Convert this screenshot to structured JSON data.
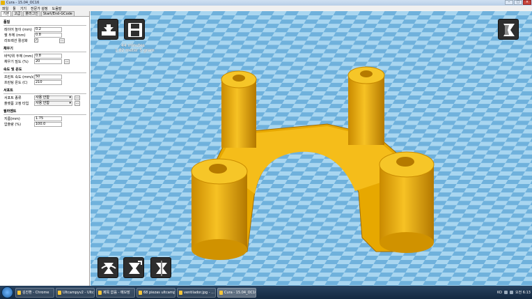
{
  "window": {
    "title": "Cura - 15.04_OC16"
  },
  "menu": [
    "파일",
    "툴",
    "기기",
    "전문가 설정",
    "도움말"
  ],
  "tabs": [
    "기본",
    "고급",
    "플러그인",
    "Start/End-GCode"
  ],
  "sections": {
    "quality": {
      "title": "품질",
      "layer_height_label": "레이어 높이 (mm)",
      "layer_height": "0.2",
      "shell_label": "쉘 두께 (mm)",
      "shell": "0.8",
      "retraction_label": "리트랙션 활성화",
      "retraction_checked": "✓"
    },
    "fill": {
      "title": "채우기",
      "bottom_top_label": "바닥/위 두께 (mm)",
      "bottom_top": "0.8",
      "density_label": "채우기 밀도 (%)",
      "density": "20"
    },
    "speed": {
      "title": "속도 및 온도",
      "print_speed_label": "프린트 속도 (mm/s)",
      "print_speed": "50",
      "temp_label": "프린팅 온도 (C)",
      "temp": "210"
    },
    "support": {
      "title": "서포트",
      "type_label": "서포트 종류",
      "type": "사용 안함",
      "adhesion_label": "플랫폼 고정 타입",
      "adhesion": "사용 안함",
      "more": "..."
    },
    "filament": {
      "title": "필라멘트",
      "diameter_label": "지름(mm)",
      "diameter": "1.75",
      "flow_label": "압출량 (%)",
      "flow": "100.0"
    }
  },
  "viewport": {
    "estimate_time": "44 minutes",
    "estimate_material": "1.82 meter 5 gram",
    "model_color": "#f2b614",
    "floor_light": "#a9d6f0",
    "floor_dark": "#6fb1dc"
  },
  "taskbar": {
    "tasks": [
      "김진환 - Chrome",
      "Ultcampyv2 - Ultc...",
      "제목 없음 - 메모장",
      "68 piezas ultcamp...",
      "ventilador.jpg - ...",
      "Cura - 15.04_OC16"
    ],
    "lang": "KO",
    "clock": "오전 6:13"
  }
}
